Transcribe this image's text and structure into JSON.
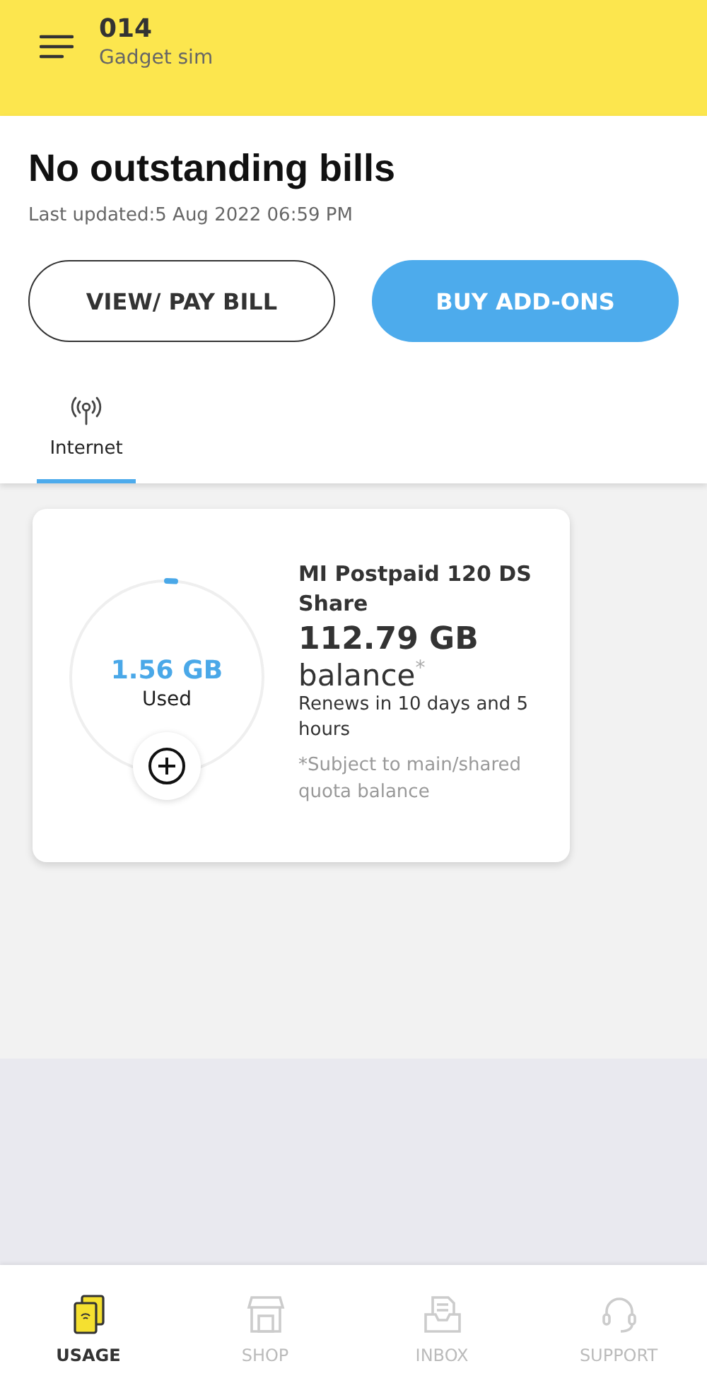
{
  "header": {
    "title": "014",
    "subtitle": "Gadget sim"
  },
  "bill": {
    "title": "No outstanding bills",
    "updated": "Last updated:5 Aug 2022 06:59 PM"
  },
  "actions": [
    {
      "label": "VIEW/ PAY BILL",
      "kind": "outline"
    },
    {
      "label": "BUY ADD-ONS",
      "kind": "filled"
    }
  ],
  "tabs": [
    {
      "label": "Internet",
      "selected": true
    }
  ],
  "plan_card": {
    "used_value": "1.56 GB",
    "used_label": "Used",
    "level": 0.014,
    "plan_name": "MI Postpaid 120 DS Share",
    "balance_value": "112.79 GB",
    "balance_label": "balance",
    "balance_mark": "*",
    "renews": "Renews in 10 days and 5 hours",
    "note": "*Subject to main/shared quota balance"
  },
  "bottom_nav": [
    {
      "label": "USAGE",
      "kind": "usage",
      "selected": true
    },
    {
      "label": "SHOP",
      "kind": "shop",
      "selected": false
    },
    {
      "label": "INBOX",
      "kind": "inbox",
      "selected": false
    },
    {
      "label": "SUPPORT",
      "kind": "support",
      "selected": false
    }
  ]
}
